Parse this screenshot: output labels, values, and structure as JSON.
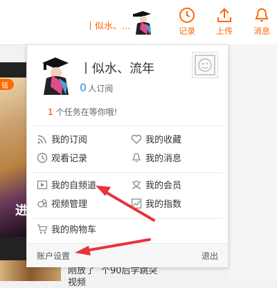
{
  "header": {
    "username": "丨似水、...",
    "buttons": [
      {
        "label": "记录",
        "icon": "clock-icon"
      },
      {
        "label": "上传",
        "icon": "upload-icon"
      },
      {
        "label": "消息",
        "icon": "bell-icon"
      }
    ]
  },
  "panel": {
    "name": "丨似水、流年",
    "subscribers": "0",
    "subscribers_label": "人订阅",
    "task_count": "1",
    "task_text": "个任务在等你哦!",
    "menu": [
      {
        "label": "我的订阅",
        "icon": "rss-icon"
      },
      {
        "label": "我的收藏",
        "icon": "heart-icon"
      },
      {
        "label": "观看记录",
        "icon": "clock-icon"
      },
      {
        "label": "我的消息",
        "icon": "bell-icon"
      },
      {
        "label": "我的自频道",
        "icon": "play-icon"
      },
      {
        "label": "我的会员",
        "icon": "vip-icon"
      },
      {
        "label": "视频管理",
        "icon": "video-manage-icon"
      },
      {
        "label": "我的指数",
        "icon": "chart-icon"
      },
      {
        "label": "我的购物车",
        "icon": "cart-icon"
      }
    ],
    "footer": {
      "settings": "账户设置",
      "logout": "退出"
    }
  },
  "background": {
    "badge": "铭",
    "left_text": "进",
    "bottom_text_1": "刚放了",
    "bottom_text_2": "个90后学跳突",
    "bottom_text_3": "视频"
  },
  "colors": {
    "accent": "#ff6600",
    "link": "#2a9ae8",
    "arrow": "#e8323c"
  }
}
